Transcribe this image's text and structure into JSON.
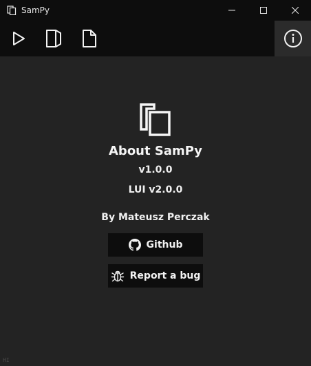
{
  "window": {
    "title": "SamPy",
    "icons": {
      "app": "app-copy-icon",
      "minimize": "minimize-icon",
      "maximize": "maximize-icon",
      "close": "close-icon"
    }
  },
  "toolbar": {
    "buttons": [
      {
        "name": "run",
        "icon": "play-icon"
      },
      {
        "name": "open",
        "icon": "folded-document-icon"
      },
      {
        "name": "new",
        "icon": "document-icon"
      }
    ],
    "info_icon": "info-icon"
  },
  "about": {
    "logo_icon": "copy-logo-icon",
    "title": "About SamPy",
    "version": "v1.0.0",
    "lui_version": "LUI v2.0.0",
    "author": "By Mateusz Perczak"
  },
  "actions": {
    "github_label": "Github",
    "github_icon": "github-icon",
    "bug_label": "Report a bug",
    "bug_icon": "bug-icon"
  },
  "corner": {
    "text": "HI"
  },
  "colors": {
    "background": "#232323",
    "bar": "#0d0d0d",
    "info_area": "#2b2b2b",
    "text": "#f2f2f2"
  }
}
